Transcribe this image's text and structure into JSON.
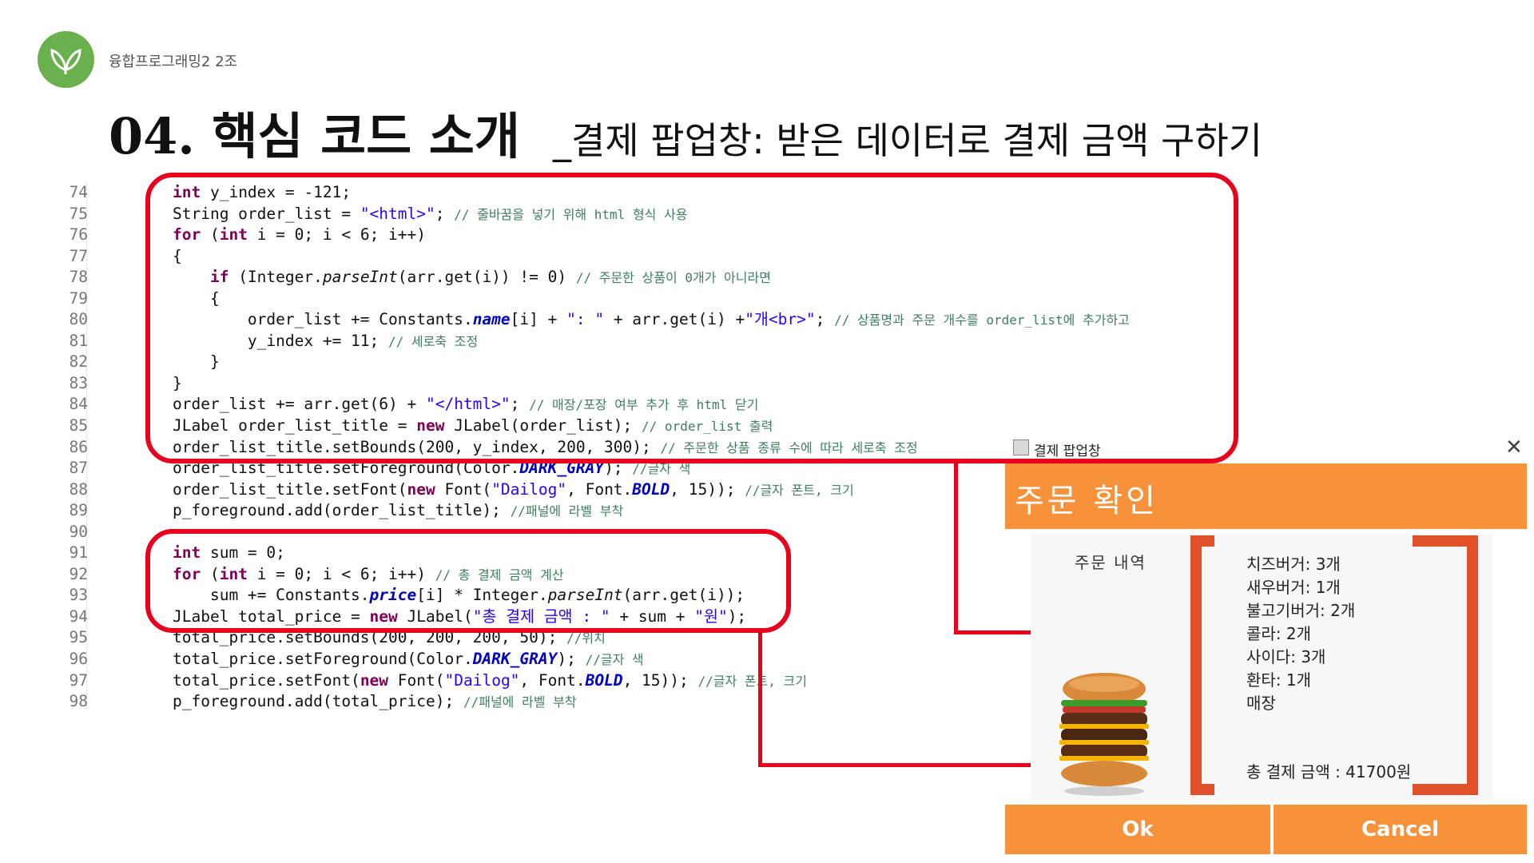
{
  "header": {
    "team": "융합프로그래밍2 2조",
    "title": "04. 핵심 코드 소개",
    "subtitle": "_결제 팝업창: 받은 데이터로 결제 금액 구하기"
  },
  "code": {
    "line_numbers": [
      "74",
      "75",
      "76",
      "77",
      "78",
      "79",
      "80",
      "81",
      "82",
      "83",
      "84",
      "85",
      "86",
      "87",
      "88",
      "89",
      "90",
      "91",
      "92",
      "93",
      "94",
      "95",
      "96",
      "97",
      "98"
    ],
    "lines": [
      "int y_index = -121;",
      "String order_list = \"<html>\"; // 줄바꿈을 넣기 위해 html 형식 사용",
      "for (int i = 0; i < 6; i++)",
      "{",
      "    if (Integer.parseInt(arr.get(i)) != 0) // 주문한 상품이 0개가 아니라면",
      "    {",
      "        order_list += Constants.name[i] + \": \" + arr.get(i) +\"개<br>\"; // 상품명과 주문 개수를 order_list에 추가하고",
      "        y_index += 11; // 세로축 조정",
      "    }",
      "}",
      "order_list += arr.get(6) + \"</html>\"; // 매장/포장 여부 추가 후 html 닫기",
      "JLabel order_list_title = new JLabel(order_list); // order_list 출력",
      "order_list_title.setBounds(200, y_index, 200, 300); // 주문한 상품 종류 수에 따라 세로축 조정",
      "order_list_title.setForeground(Color.DARK_GRAY); //글자 색",
      "order_list_title.setFont(new Font(\"Dailog\", Font.BOLD, 15)); //글자 폰트, 크기",
      "p_foreground.add(order_list_title); //패널에 라벨 부착",
      "",
      "int sum = 0;",
      "for (int i = 0; i < 6; i++) // 총 결제 금액 계산",
      "    sum += Constants.price[i] * Integer.parseInt(arr.get(i));",
      "JLabel total_price = new JLabel(\"총 결제 금액 : \" + sum + \"원\");",
      "total_price.setBounds(200, 200, 200, 50); //위치",
      "total_price.setForeground(Color.DARK_GRAY); //글자 색",
      "total_price.setFont(new Font(\"Dailog\", Font.BOLD, 15)); //글자 폰트, 크기",
      "p_foreground.add(total_price); //패널에 라벨 부착"
    ]
  },
  "popup": {
    "window_title": "결제 팝업창",
    "close_symbol": "✕",
    "header": "주문 확인",
    "order_label": "주문 내역",
    "items": [
      "치즈버거: 3개",
      "새우버거: 1개",
      "불고기버거: 2개",
      "콜라: 2개",
      "사이다: 3개",
      "환타: 1개",
      "매장"
    ],
    "total": "총 결제 금액 : 41700원",
    "ok_label": "Ok",
    "cancel_label": "Cancel",
    "icon": "app-window-icon"
  },
  "colors": {
    "accent": "#f7923a",
    "highlight": "#e8001c",
    "bracket": "#e0512a",
    "logo": "#6ab04c"
  }
}
